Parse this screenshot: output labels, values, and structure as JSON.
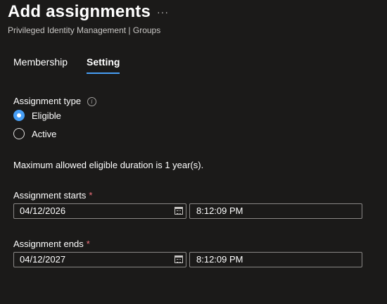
{
  "header": {
    "title": "Add assignments",
    "more_label": "···",
    "subtitle": "Privileged Identity Management | Groups"
  },
  "tabs": [
    {
      "label": "Membership",
      "active": false
    },
    {
      "label": "Setting",
      "active": true
    }
  ],
  "assignment_type": {
    "label": "Assignment type",
    "info_icon": "info-icon",
    "options": [
      {
        "label": "Eligible",
        "selected": true
      },
      {
        "label": "Active",
        "selected": false
      }
    ]
  },
  "info_text": "Maximum allowed eligible duration is 1 year(s).",
  "assignment_starts": {
    "label": "Assignment starts",
    "required_mark": "*",
    "date": "04/12/2026",
    "time": "8:12:09 PM"
  },
  "assignment_ends": {
    "label": "Assignment ends",
    "required_mark": "*",
    "date": "04/12/2027",
    "time": "8:12:09 PM"
  },
  "colors": {
    "background": "#1b1a19",
    "accent": "#479ef5",
    "required": "#f1707b"
  }
}
